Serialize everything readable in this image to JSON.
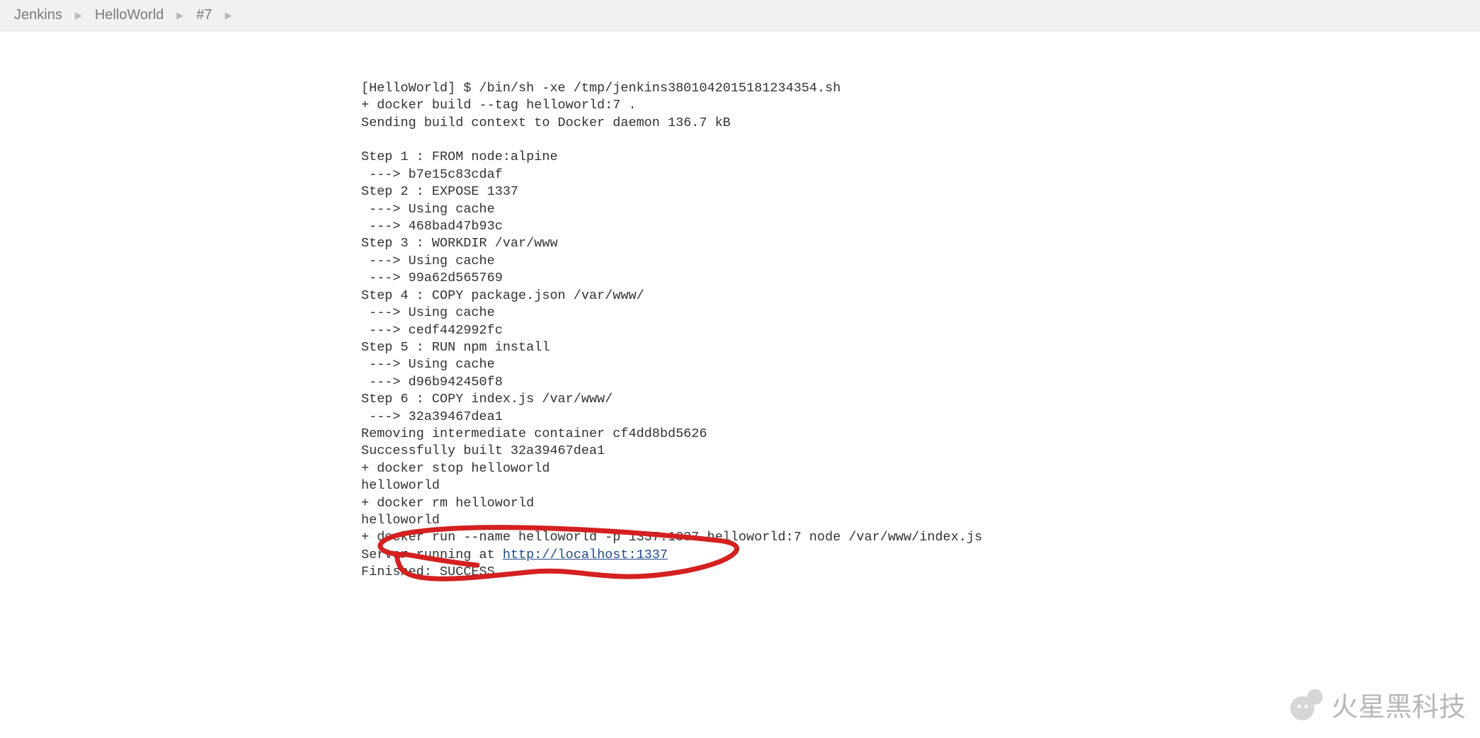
{
  "breadcrumb": {
    "root": "Jenkins",
    "job": "HelloWorld",
    "build": "#7"
  },
  "console": {
    "lines": [
      "[HelloWorld] $ /bin/sh -xe /tmp/jenkins3801042015181234354.sh",
      "+ docker build --tag helloworld:7 .",
      "Sending build context to Docker daemon 136.7 kB",
      "",
      "Step 1 : FROM node:alpine",
      " ---> b7e15c83cdaf",
      "Step 2 : EXPOSE 1337",
      " ---> Using cache",
      " ---> 468bad47b93c",
      "Step 3 : WORKDIR /var/www",
      " ---> Using cache",
      " ---> 99a62d565769",
      "Step 4 : COPY package.json /var/www/",
      " ---> Using cache",
      " ---> cedf442992fc",
      "Step 5 : RUN npm install",
      " ---> Using cache",
      " ---> d96b942450f8",
      "Step 6 : COPY index.js /var/www/",
      " ---> 32a39467dea1",
      "Removing intermediate container cf4dd8bd5626",
      "Successfully built 32a39467dea1",
      "+ docker stop helloworld",
      "helloworld",
      "+ docker rm helloworld",
      "helloworld",
      "+ docker run --name helloworld -p 1337:1337 helloworld:7 node /var/www/index.js"
    ],
    "server_line_pre": "Server running at ",
    "server_url": "http://localhost:1337",
    "finished_line": "Finished: SUCCESS"
  },
  "watermark": {
    "text": "火星黑科技"
  }
}
